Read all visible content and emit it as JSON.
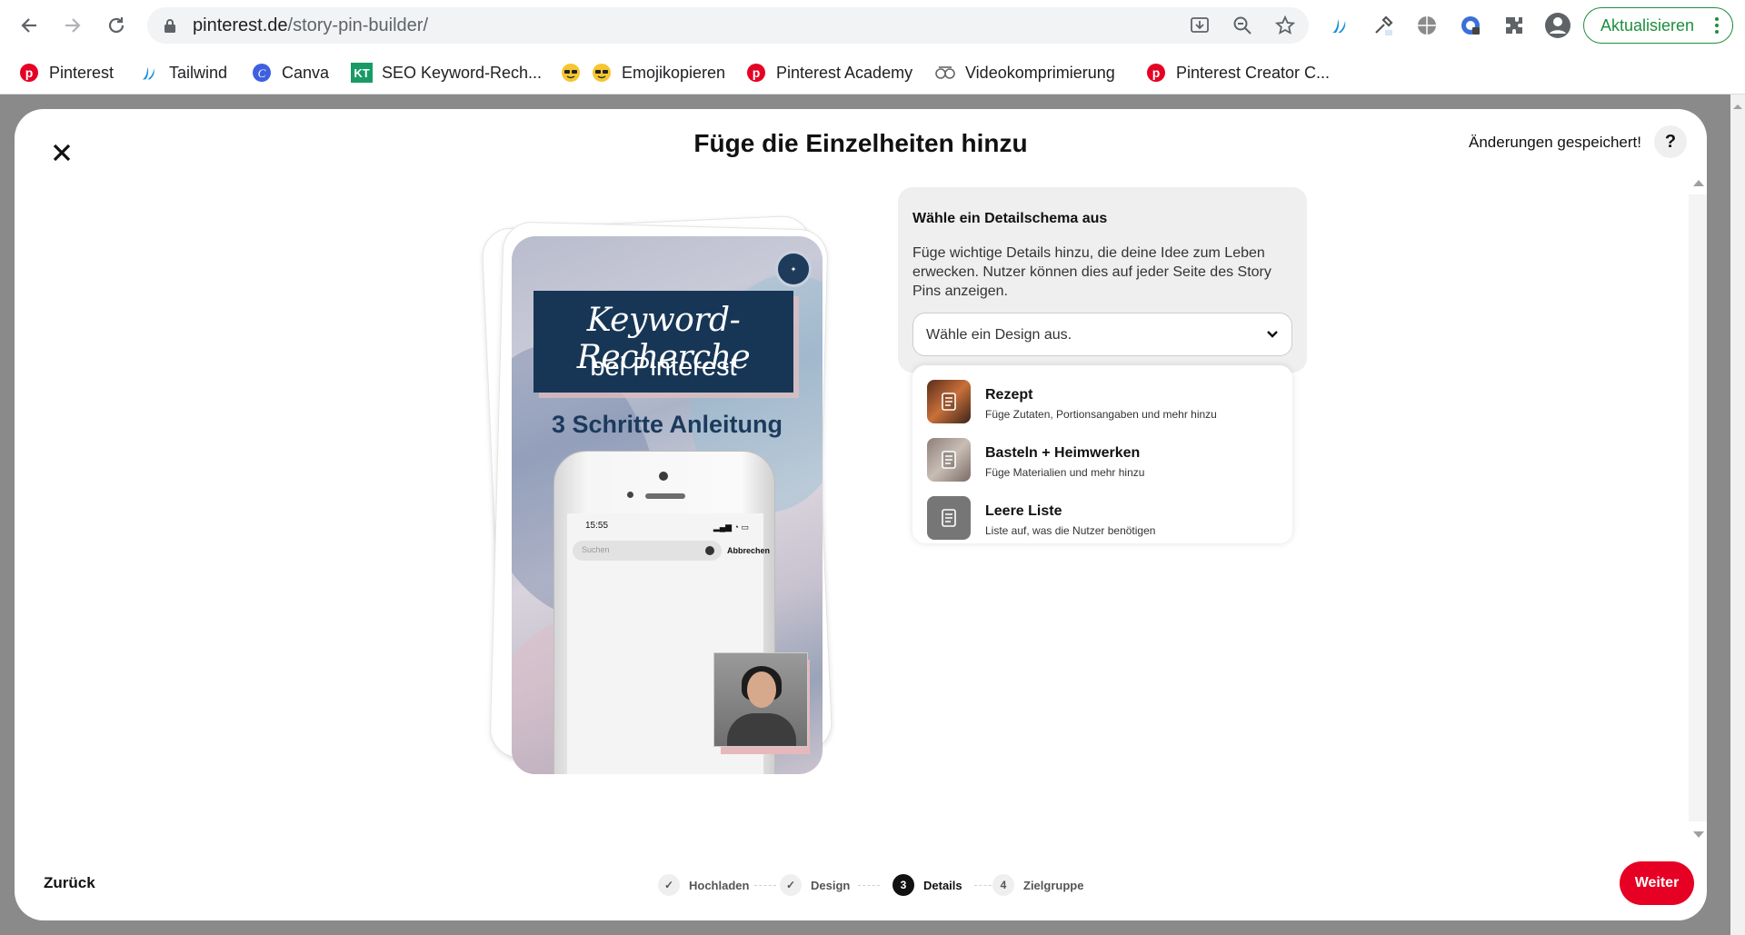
{
  "browser": {
    "url_host": "pinterest.de",
    "url_path": "/story-pin-builder/",
    "update_label": "Aktualisieren"
  },
  "bookmarks": [
    {
      "label": "Pinterest",
      "icon": "pinterest-icon"
    },
    {
      "label": "Tailwind",
      "icon": "tailwind-icon"
    },
    {
      "label": "Canva",
      "icon": "canva-icon"
    },
    {
      "label": "SEO Keyword-Rech...",
      "icon": "kt-icon"
    },
    {
      "label": "Emojikopieren",
      "icon": "emoji-icon"
    },
    {
      "label": "Pinterest Academy",
      "icon": "pinterest-icon"
    },
    {
      "label": "Videokomprimierung",
      "icon": "video-icon"
    },
    {
      "label": "Pinterest Creator C...",
      "icon": "pinterest-icon"
    }
  ],
  "modal": {
    "title": "Füge die Einzelheiten hinzu",
    "saved_status": "Änderungen gespeichert!",
    "help_label": "?"
  },
  "preview": {
    "script_title": "Keyword-Recherche",
    "subtitle": "bei Pinterest",
    "steps_text": "3 Schritte Anleitung",
    "phone_time": "15:55",
    "phone_search_placeholder": "Suchen",
    "phone_cancel": "Abbrechen"
  },
  "details_panel": {
    "title": "Wähle ein Detailschema aus",
    "description": "Füge wichtige Details hinzu, die deine Idee zum Leben erwecken. Nutzer können dies auf jeder Seite des Story Pins anzeigen.",
    "select_placeholder": "Wähle ein Design aus.",
    "options": [
      {
        "name": "Rezept",
        "sub": "Füge Zutaten, Portionsangaben und mehr hinzu",
        "icon": "document-icon"
      },
      {
        "name": "Basteln + Heimwerken",
        "sub": "Füge Materialien und mehr hinzu",
        "icon": "document-icon"
      },
      {
        "name": "Leere Liste",
        "sub": "Liste auf, was die Nutzer benötigen",
        "icon": "document-icon"
      }
    ]
  },
  "footer": {
    "back_label": "Zurück",
    "next_label": "Weiter",
    "steps": [
      {
        "number": "✓",
        "label": "Hochladen",
        "state": "done"
      },
      {
        "number": "✓",
        "label": "Design",
        "state": "done"
      },
      {
        "number": "3",
        "label": "Details",
        "state": "active"
      },
      {
        "number": "4",
        "label": "Zielgruppe",
        "state": "upcoming"
      }
    ]
  },
  "colors": {
    "pinterest_red": "#e60023",
    "update_green": "#1e8e3e",
    "card_navy": "#173656"
  }
}
